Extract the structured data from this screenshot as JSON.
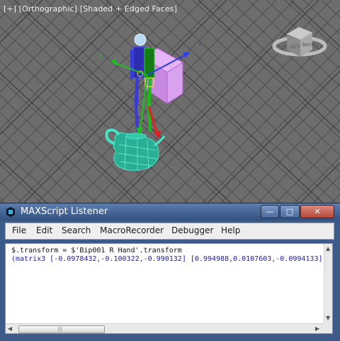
{
  "viewport": {
    "label_parts": [
      "[+]",
      "[Orthographic]",
      "[Shaded + Edged Faces]"
    ],
    "viewcube_icon": "viewcube-icon",
    "gizmo_axis_labels": {
      "x": "x",
      "y": "y",
      "z": "z"
    }
  },
  "listener": {
    "title": "MAXScript Listener",
    "app_icon": "3dsmax-logo-icon",
    "window_buttons": {
      "minimize": "—",
      "maximize": "□",
      "close": "✕"
    },
    "menu": [
      "File",
      "Edit",
      "Search",
      "MacroRecorder",
      "Debugger",
      "Help"
    ],
    "lines": [
      "$.transform = $'Bip001 R Hand'.transform",
      "(matrix3 [-0.0978432,-0.100322,-0.990132] [0.994988,0.0107603,-0.0994133]"
    ],
    "scroll_grip": "|||"
  },
  "colors": {
    "viewport_bg": "#6d6d6d",
    "grid": "#4f4f4f",
    "listener_frame": "#3d5b88",
    "input_text": "#111111",
    "output_text": "#1c1cb4",
    "teapot": "#2fd3b4",
    "box": "#d08fe8"
  }
}
